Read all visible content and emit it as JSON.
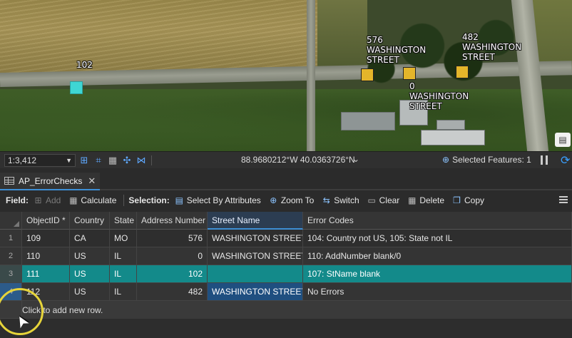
{
  "map": {
    "labels": {
      "p102": "102",
      "p576": [
        "576",
        "WASHINGTON",
        "STREET"
      ],
      "p0": [
        "0",
        "WASHINGTON",
        "STREET"
      ],
      "p482": [
        "482",
        "WASHINGTON",
        "STREET"
      ]
    },
    "colors": {
      "address_point": "#e4b52a",
      "selected_point": "#3fd6d4"
    }
  },
  "statusbar": {
    "scale": "1:3,412",
    "coordinates": "88.9680212°W 40.0363726°N",
    "selected_features_label": "Selected Features: 1"
  },
  "tab": {
    "title": "AP_ErrorChecks"
  },
  "toolbar": {
    "field_label": "Field:",
    "add": "Add",
    "calculate": "Calculate",
    "selection_label": "Selection:",
    "select_by_attributes": "Select By Attributes",
    "zoom_to": "Zoom To",
    "switch": "Switch",
    "clear": "Clear",
    "delete": "Delete",
    "copy": "Copy"
  },
  "table": {
    "columns": [
      "ObjectID *",
      "Country",
      "State",
      "Address Number",
      "Street Name",
      "Error Codes"
    ],
    "rows": [
      {
        "num": "1",
        "cells": [
          "109",
          "CA",
          "MO",
          "576",
          "WASHINGTON STREET",
          "104: Country not US, 105: State not IL"
        ]
      },
      {
        "num": "2",
        "cells": [
          "110",
          "US",
          "IL",
          "0",
          "WASHINGTON STREET",
          "110: AddNumber blank/0"
        ]
      },
      {
        "num": "3",
        "cells": [
          "111",
          "US",
          "IL",
          "102",
          "",
          "107: StName blank"
        ]
      },
      {
        "num": "4",
        "cells": [
          "112",
          "US",
          "IL",
          "482",
          "WASHINGTON STREET",
          "No Errors"
        ]
      }
    ],
    "add_row_text": "Click to add new row."
  }
}
